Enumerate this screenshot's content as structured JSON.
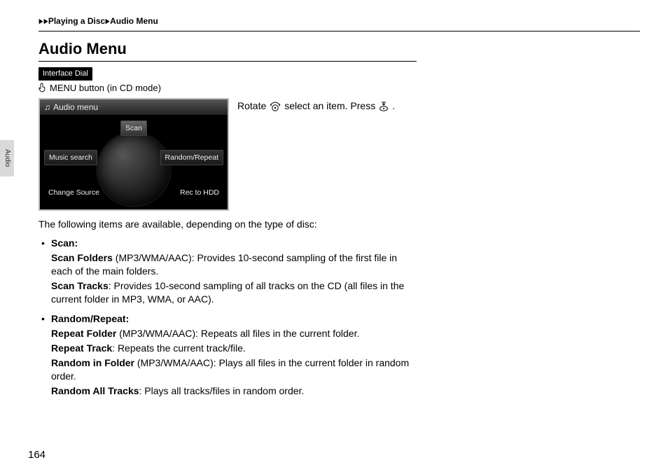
{
  "breadcrumb": {
    "a": "Playing a Disc",
    "b": "Audio Menu"
  },
  "title": "Audio Menu",
  "pill": "Interface Dial",
  "menu_button": "MENU button (in CD mode)",
  "instr": {
    "pre": "Rotate",
    "mid": "select an item. Press",
    "post": "."
  },
  "screen": {
    "title": "Audio menu",
    "scan": "Scan",
    "music": "Music search",
    "rr": "Random/Repeat",
    "cs": "Change Source",
    "rec": "Rec to HDD"
  },
  "intro": "The following items are available, depending on the type of disc:",
  "scan": {
    "head": "Scan:",
    "folders_b": "Scan Folders",
    "folders_t": " (MP3/WMA/AAC): Provides 10-second sampling of the first file in each of the main folders.",
    "tracks_b": "Scan Tracks",
    "tracks_t": ": Provides 10-second sampling of all tracks on the CD (all files in the current folder in MP3, WMA, or AAC)."
  },
  "rr": {
    "head": "Random/Repeat:",
    "rf_b": "Repeat Folder",
    "rf_t": " (MP3/WMA/AAC): Repeats all files in the current folder.",
    "rt_b": "Repeat Track",
    "rt_t": ": Repeats the current track/file.",
    "rif_b": "Random in Folder",
    "rif_t": " (MP3/WMA/AAC): Plays all files in the current folder in random order.",
    "rat_b": "Random All Tracks",
    "rat_t": ": Plays all tracks/files in random order."
  },
  "side_tab": "Audio",
  "page_number": "164"
}
